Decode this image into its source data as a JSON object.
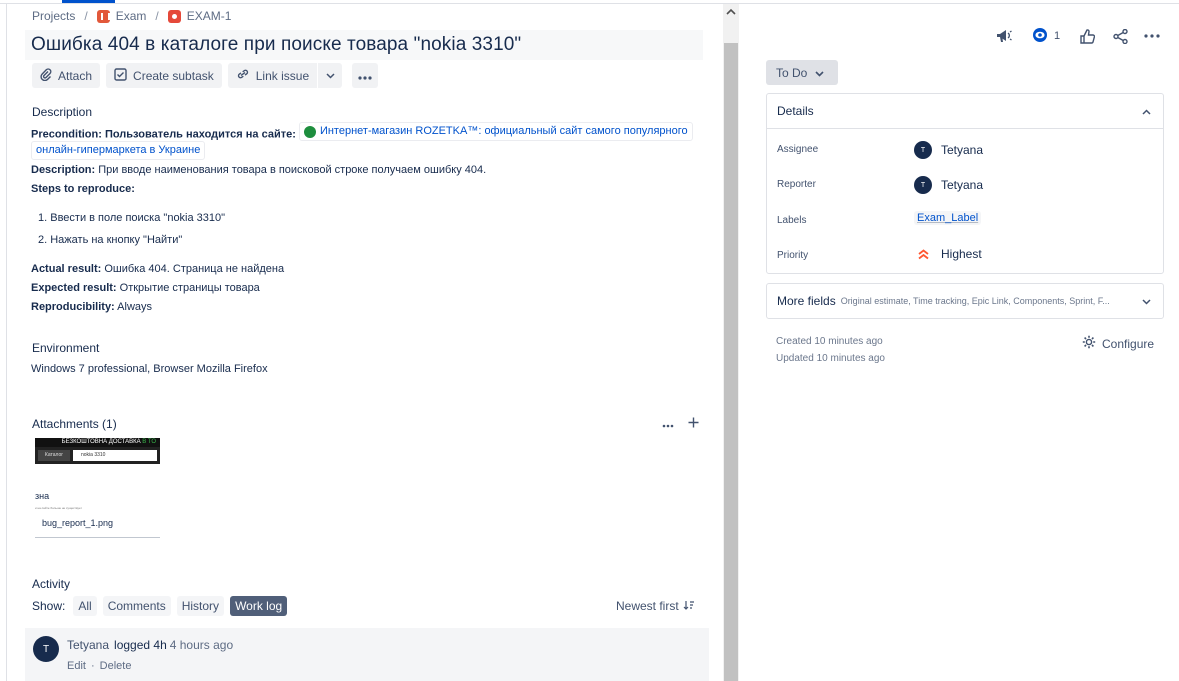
{
  "breadcrumb": {
    "projects": "Projects",
    "project": "Exam",
    "issue_key": "EXAM-1"
  },
  "issue": {
    "title": "Ошибка 404 в каталоге при поиске товара \"nokia 3310\""
  },
  "toolbar": {
    "attach": "Attach",
    "create_subtask": "Create subtask",
    "link_issue": "Link issue"
  },
  "description": {
    "heading": "Description",
    "precondition_label": "Precondition: Пользователь находится на сайте:",
    "link_text": "Интернет-магазин ROZETKA™: официальный сайт самого популярного",
    "link_text_2": "онлайн-гипермаркета в Украине",
    "desc_label": "Description:",
    "desc_text": " При вводе наименования товара в поисковой строке получаем ошибку 404.",
    "steps_label": "Steps to reproduce:",
    "steps": [
      "1. Ввести в поле поиска \"nokia 3310\"",
      "2. Нажать на кнопку \"Найти\""
    ],
    "actual_label": "Actual result:",
    "actual_text": "  Ошибка 404. Страница не найдена",
    "expected_label": "Expected result:",
    "expected_text": " Открытие страницы товара",
    "repro_label": "Reproducibility:",
    "repro_text": " Always"
  },
  "environment": {
    "heading": "Environment",
    "text": "Windows 7 professional, Browser Mozilla Firefox"
  },
  "attachments": {
    "heading": "Attachments (1)",
    "thumb_banner_a": "БЕЗКОШТОВНА ДОСТАВКА ",
    "thumb_banner_b": "В ТО",
    "thumb_catalog": "Каталог",
    "thumb_search": "nokia 3310",
    "thumb_snip": "зна",
    "thumb_tiny": "и на сайте больше не существует",
    "file_name": "bug_report_1.png"
  },
  "activity": {
    "heading": "Activity",
    "show_label": "Show:",
    "filters": [
      "All",
      "Comments",
      "History",
      "Work log"
    ],
    "active_filter": "Work log",
    "sort": "Newest first"
  },
  "worklog": {
    "avatar": "T",
    "user": "Tetyana",
    "action": "logged 4h",
    "time": "4 hours ago",
    "edit": "Edit",
    "delete": "Delete"
  },
  "header_right": {
    "watchers": "1"
  },
  "status": {
    "label": "To Do"
  },
  "details": {
    "heading": "Details",
    "assignee_label": "Assignee",
    "assignee": "Tetyana",
    "reporter_label": "Reporter",
    "reporter": "Tetyana",
    "labels_label": "Labels",
    "label_value": "Exam_Label",
    "priority_label": "Priority",
    "priority": "Highest",
    "avatar_letter": "T"
  },
  "more_fields": {
    "title": "More fields",
    "hint": "Original estimate, Time tracking, Epic Link, Components, Sprint, F..."
  },
  "meta": {
    "created": "Created 10 minutes ago",
    "updated": "Updated 10 minutes ago",
    "configure": "Configure"
  },
  "colors": {
    "accent": "#0052cc",
    "priority_highest": "#ff5630",
    "text": "#172b4d"
  }
}
